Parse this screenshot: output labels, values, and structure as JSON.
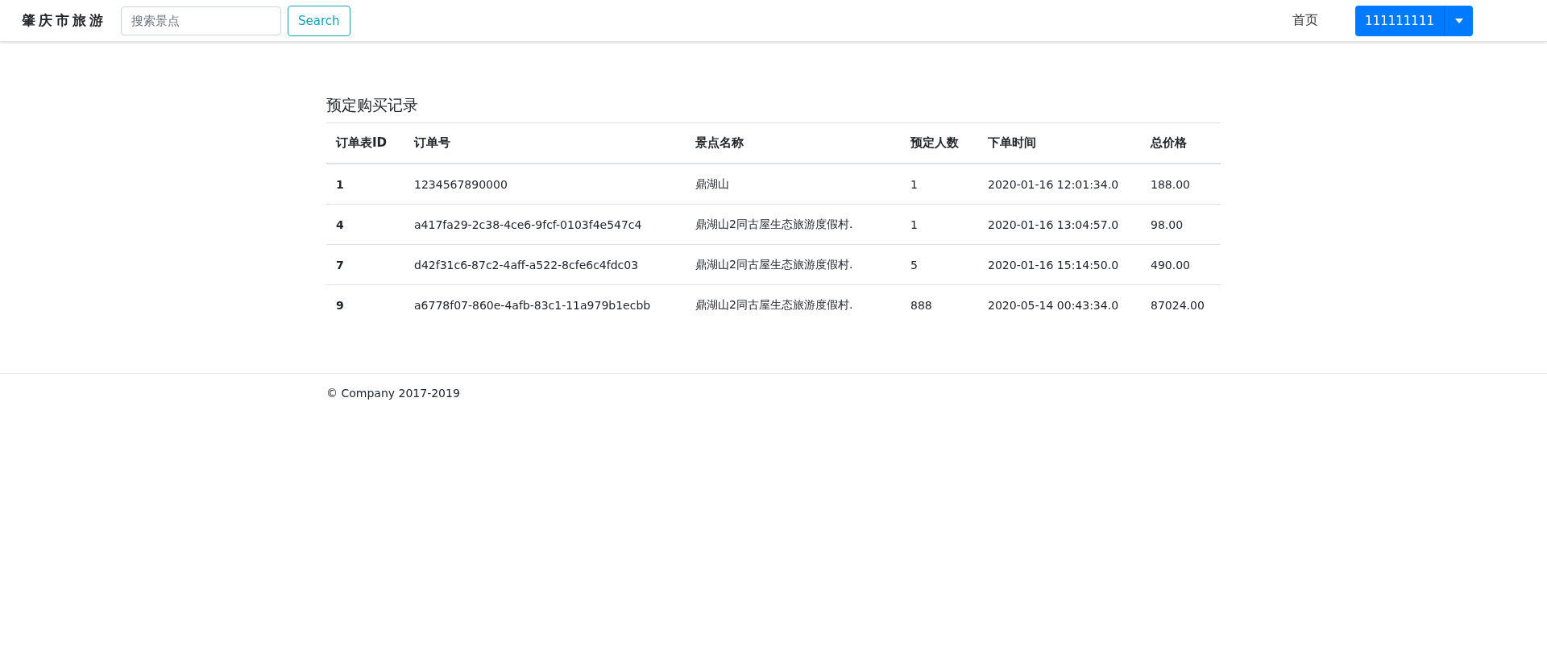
{
  "navbar": {
    "brand": "肇庆市旅游",
    "search": {
      "placeholder": "搜索景点",
      "button": "Search"
    },
    "home_link": "首页",
    "user_button": "111111111"
  },
  "section_title": "预定购买记录",
  "table": {
    "columns": [
      "订单表ID",
      "订单号",
      "景点名称",
      "预定人数",
      "下单时间",
      "总价格"
    ],
    "rows": [
      [
        "1",
        "1234567890000",
        "鼎湖山",
        "1",
        "2020-01-16 12:01:34.0",
        "188.00"
      ],
      [
        "4",
        "a417fa29-2c38-4ce6-9fcf-0103f4e547c4",
        "鼎湖山2同古屋生态旅游度假村.",
        "1",
        "2020-01-16 13:04:57.0",
        "98.00"
      ],
      [
        "7",
        "d42f31c6-87c2-4aff-a522-8cfe6c4fdc03",
        "鼎湖山2同古屋生态旅游度假村.",
        "5",
        "2020-01-16 15:14:50.0",
        "490.00"
      ],
      [
        "9",
        "a6778f07-860e-4afb-83c1-11a979b1ecbb",
        "鼎湖山2同古屋生态旅游度假村.",
        "888",
        "2020-05-14 00:43:34.0",
        "87024.00"
      ]
    ]
  },
  "footer": "© Company 2017-2019"
}
